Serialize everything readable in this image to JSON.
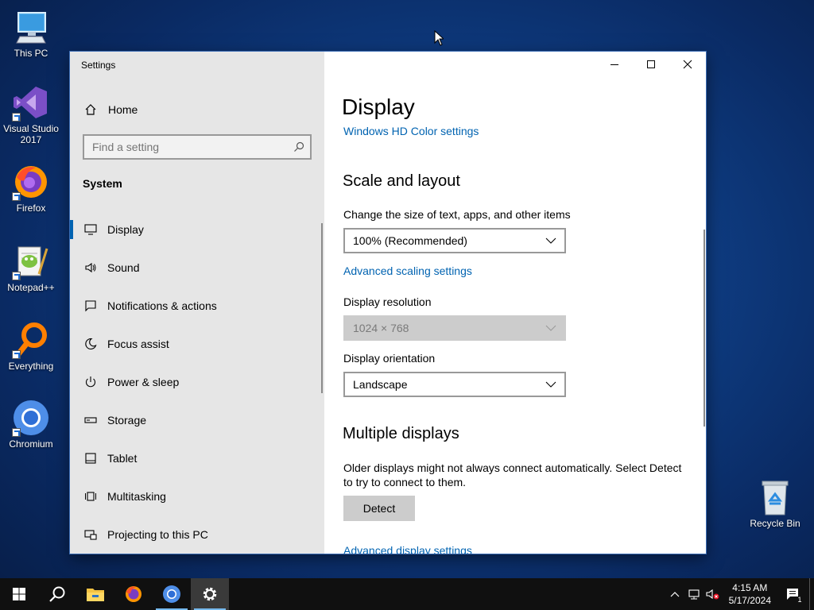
{
  "desktop": {
    "icons": [
      {
        "label": "This PC",
        "icon": "this-pc-icon"
      },
      {
        "label": "Visual Studio 2017",
        "icon": "visual-studio-icon"
      },
      {
        "label": "Firefox",
        "icon": "firefox-icon"
      },
      {
        "label": "Notepad++",
        "icon": "notepadpp-icon"
      },
      {
        "label": "Everything",
        "icon": "everything-icon"
      },
      {
        "label": "Chromium",
        "icon": "chromium-icon"
      },
      {
        "label": "Recycle Bin",
        "icon": "recycle-bin-icon"
      }
    ]
  },
  "window": {
    "title": "Settings",
    "sidebar": {
      "home_label": "Home",
      "search_placeholder": "Find a setting",
      "group_title": "System",
      "items": [
        {
          "label": "Display",
          "icon": "monitor-icon",
          "active": true
        },
        {
          "label": "Sound",
          "icon": "speaker-icon"
        },
        {
          "label": "Notifications & actions",
          "icon": "notification-icon"
        },
        {
          "label": "Focus assist",
          "icon": "moon-icon"
        },
        {
          "label": "Power & sleep",
          "icon": "power-icon"
        },
        {
          "label": "Storage",
          "icon": "storage-icon"
        },
        {
          "label": "Tablet",
          "icon": "tablet-icon"
        },
        {
          "label": "Multitasking",
          "icon": "multitasking-icon"
        },
        {
          "label": "Projecting to this PC",
          "icon": "projecting-icon"
        }
      ]
    },
    "content": {
      "page_title": "Display",
      "hd_color_link": "Windows HD Color settings",
      "scale_section": "Scale and layout",
      "scale_label": "Change the size of text, apps, and other items",
      "scale_value": "100% (Recommended)",
      "advanced_scaling_link": "Advanced scaling settings",
      "resolution_label": "Display resolution",
      "resolution_value": "1024 × 768",
      "orientation_label": "Display orientation",
      "orientation_value": "Landscape",
      "multi_section": "Multiple displays",
      "multi_desc": "Older displays might not always connect automatically. Select Detect to try to connect to them.",
      "detect_label": "Detect",
      "advanced_display_link": "Advanced display settings"
    }
  },
  "taskbar": {
    "time": "4:15 AM",
    "date": "5/17/2024",
    "notification_count": "1"
  },
  "colors": {
    "accent": "#0063b1",
    "sidebar_bg": "#e6e6e6",
    "taskbar_bg": "#101010"
  }
}
